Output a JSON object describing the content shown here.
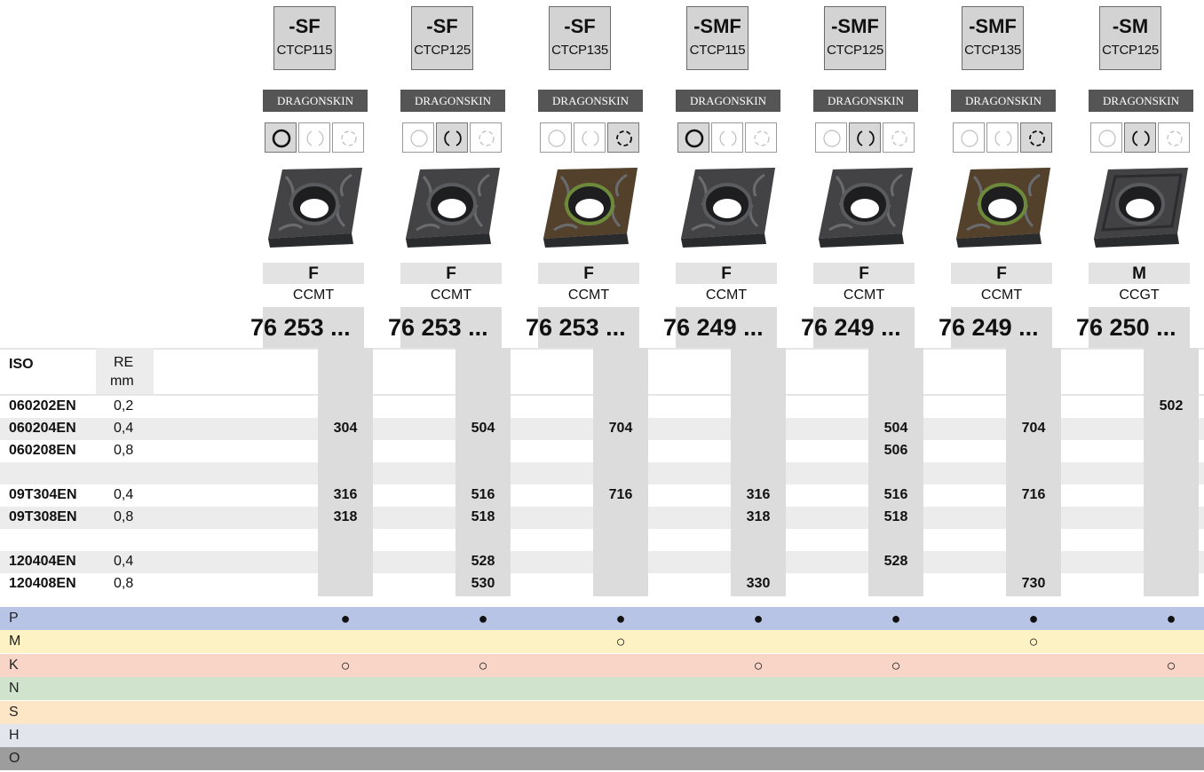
{
  "brand_label": "DRAGONSKIN",
  "columns": [
    {
      "tag": "-SF",
      "grade": "CTCP115",
      "usage": "F",
      "type": "CCMT",
      "article": "76 253 ...",
      "circle": 0,
      "insert_style": "dark"
    },
    {
      "tag": "-SF",
      "grade": "CTCP125",
      "usage": "F",
      "type": "CCMT",
      "article": "76 253 ...",
      "circle": 1,
      "insert_style": "dark"
    },
    {
      "tag": "-SF",
      "grade": "CTCP135",
      "usage": "F",
      "type": "CCMT",
      "article": "76 253 ...",
      "circle": 2,
      "insert_style": "bronze"
    },
    {
      "tag": "-SMF",
      "grade": "CTCP115",
      "usage": "F",
      "type": "CCMT",
      "article": "76 249 ...",
      "circle": 0,
      "insert_style": "dark"
    },
    {
      "tag": "-SMF",
      "grade": "CTCP125",
      "usage": "F",
      "type": "CCMT",
      "article": "76 249 ...",
      "circle": 1,
      "insert_style": "dark"
    },
    {
      "tag": "-SMF",
      "grade": "CTCP135",
      "usage": "F",
      "type": "CCMT",
      "article": "76 249 ...",
      "circle": 2,
      "insert_style": "bronze"
    },
    {
      "tag": "-SM",
      "grade": "CTCP125",
      "usage": "M",
      "type": "CCGT",
      "article": "76 250 ...",
      "circle": 1,
      "insert_style": "plain"
    }
  ],
  "table_header": {
    "iso": "ISO",
    "re": "RE",
    "re_unit": "mm"
  },
  "rows": [
    {
      "iso": "060202EN",
      "re": "0,2",
      "values": [
        "",
        "",
        "",
        "",
        "",
        "",
        "502"
      ]
    },
    {
      "iso": "060204EN",
      "re": "0,4",
      "values": [
        "304",
        "504",
        "704",
        "",
        "504",
        "704",
        ""
      ]
    },
    {
      "iso": "060208EN",
      "re": "0,8",
      "values": [
        "",
        "",
        "",
        "",
        "506",
        "",
        ""
      ]
    },
    {
      "iso": "",
      "re": "",
      "values": [
        "",
        "",
        "",
        "",
        "",
        "",
        ""
      ]
    },
    {
      "iso": "09T304EN",
      "re": "0,4",
      "values": [
        "316",
        "516",
        "716",
        "316",
        "516",
        "716",
        ""
      ]
    },
    {
      "iso": "09T308EN",
      "re": "0,8",
      "values": [
        "318",
        "518",
        "",
        "318",
        "518",
        "",
        ""
      ]
    },
    {
      "iso": "",
      "re": "",
      "values": [
        "",
        "",
        "",
        "",
        "",
        "",
        ""
      ]
    },
    {
      "iso": "120404EN",
      "re": "0,4",
      "values": [
        "",
        "528",
        "",
        "",
        "528",
        "",
        ""
      ]
    },
    {
      "iso": "120408EN",
      "re": "0,8",
      "values": [
        "",
        "530",
        "",
        "330",
        "",
        "730",
        ""
      ]
    }
  ],
  "materials": [
    {
      "label": "P",
      "color": "#b8c4e6",
      "marks": [
        "●",
        "●",
        "●",
        "●",
        "●",
        "●",
        "●"
      ]
    },
    {
      "label": "M",
      "color": "#fdf2c4",
      "marks": [
        "",
        "",
        "○",
        "",
        "",
        "○",
        ""
      ]
    },
    {
      "label": "K",
      "color": "#f9d5c8",
      "marks": [
        "○",
        "○",
        "",
        "○",
        "○",
        "",
        "○"
      ]
    },
    {
      "label": "N",
      "color": "#cfe3cd",
      "marks": [
        "",
        "",
        "",
        "",
        "",
        "",
        ""
      ]
    },
    {
      "label": "S",
      "color": "#fde6c6",
      "marks": [
        "",
        "",
        "",
        "",
        "",
        "",
        ""
      ]
    },
    {
      "label": "H",
      "color": "#e2e6ec",
      "marks": [
        "",
        "",
        "",
        "",
        "",
        "",
        ""
      ]
    },
    {
      "label": "O",
      "color": "#9d9d9d",
      "marks": [
        "",
        "",
        "",
        "",
        "",
        "",
        ""
      ]
    }
  ]
}
